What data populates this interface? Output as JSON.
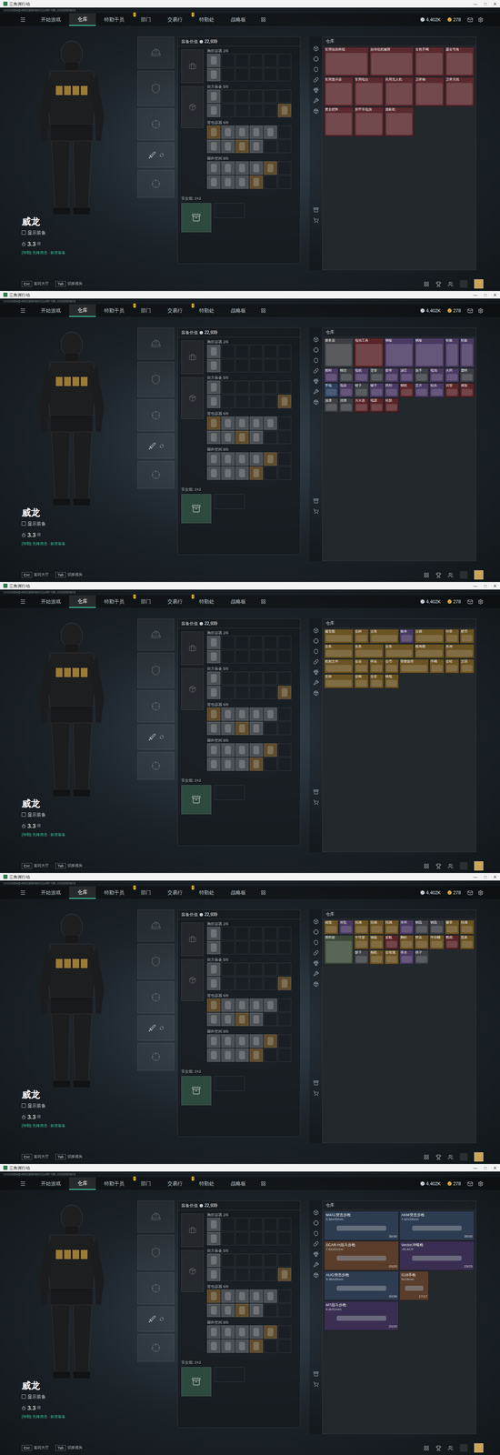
{
  "window": {
    "title": "三角洲行动",
    "controls": [
      "—",
      "□",
      "✕"
    ]
  },
  "session_id": "CH10084@49D2BB0B021148F78E.2026050823",
  "nav": {
    "tabs": [
      {
        "label": "开始游戏",
        "selected": false,
        "badge": ""
      },
      {
        "label": "仓库",
        "selected": true,
        "badge": ""
      },
      {
        "label": "特勤干员",
        "selected": false,
        "badge": ""
      },
      {
        "label": "部门",
        "selected": false,
        "badge": "!"
      },
      {
        "label": "交易行",
        "selected": false,
        "badge": ""
      },
      {
        "label": "特勤处",
        "selected": false,
        "badge": "!"
      },
      {
        "label": "战略板",
        "selected": false,
        "badge": ""
      }
    ],
    "currency": [
      {
        "value": "4.402K",
        "color": "#c9ccd0"
      },
      {
        "value": "278",
        "color": "#d9a43a"
      }
    ]
  },
  "operator": {
    "name": "威龙",
    "show_gear": {
      "label": "显示装备",
      "checked": false
    },
    "level": "3.3",
    "level_note": "级",
    "status": "[特勤] 先锋突击 · 标准装备"
  },
  "hints": [
    {
      "key": "Esc",
      "label": "返回大厅"
    },
    {
      "key": "Tab",
      "label": "切换视角"
    }
  ],
  "loadout": {
    "value_label": "装备价值",
    "value": "22,939",
    "sections": [
      {
        "label": "胸挂容器 2/6",
        "slots": [
          "ammo",
          "empty",
          "empty",
          "empty",
          "empty",
          "empty",
          "ammo",
          "empty",
          "empty",
          "empty",
          "empty",
          "empty"
        ]
      },
      {
        "label": "前方装备 5/6",
        "slots": [
          "ammo",
          "empty",
          "empty",
          "empty",
          "empty",
          "empty",
          "ammo",
          "empty",
          "empty",
          "empty",
          "empty",
          "med"
        ]
      },
      {
        "label": "背包容器 6/8",
        "slots": [
          "med",
          "ammo",
          "ammo",
          "ammo",
          "ammo",
          "empty",
          "ammo",
          "ammo",
          "med",
          "ammo",
          "empty",
          "empty"
        ]
      },
      {
        "label": "额外空间 8/8",
        "slots": [
          "ammo",
          "ammo",
          "ammo",
          "ammo",
          "med",
          "empty",
          "ammo",
          "ammo",
          "ammo",
          "med",
          "empty",
          "empty"
        ]
      }
    ],
    "safe_box": {
      "label": "安全箱: 2×2"
    }
  },
  "warehouse": {
    "title": "仓库"
  },
  "screens": [
    {
      "items": [
        {
          "name": "军用信息终端",
          "kind": "box",
          "color": "#5a2a2e"
        },
        {
          "name": "自动化机械臂",
          "kind": "box",
          "color": "#5a2a2e"
        },
        {
          "name": "金色手镯",
          "kind": "large",
          "color": "#5a2a2e"
        },
        {
          "name": "鎏金号角",
          "kind": "large",
          "color": "#5a2a2e"
        },
        {
          "name": "军用显示器",
          "kind": "large",
          "color": "#5a2a2e"
        },
        {
          "name": "军用电台",
          "kind": "large",
          "color": "#5a2a2e"
        },
        {
          "name": "民用无人机",
          "kind": "large",
          "color": "#5a2a2e"
        },
        {
          "name": "卫星锅",
          "kind": "large",
          "color": "#5a2a2e"
        },
        {
          "name": "卫星天线",
          "kind": "large",
          "color": "#5a2a2e"
        },
        {
          "name": "黄金瞪羚",
          "kind": "large",
          "color": "#5a2a2e"
        },
        {
          "name": "装甲车电池",
          "kind": "large",
          "color": "#5a2a2e"
        },
        {
          "name": "摄影机",
          "kind": "large",
          "color": "#5a2a2e"
        }
      ]
    },
    {
      "items": [
        {
          "name": "服务器",
          "kind": "large",
          "color": "#3d3f44"
        },
        {
          "name": "电动工具",
          "kind": "large",
          "color": "#5a2529"
        },
        {
          "name": "钢板",
          "kind": "large",
          "color": "#4a3a63"
        },
        {
          "name": "钢板",
          "kind": "large",
          "color": "#4a3a63"
        },
        {
          "name": "铝板",
          "kind": "tall",
          "color": "#4a3a63"
        },
        {
          "name": "铝板",
          "kind": "tall",
          "color": "#4a3a63"
        },
        {
          "name": "燃料",
          "kind": "small",
          "color": "#4a3a63"
        },
        {
          "name": "螺丝",
          "kind": "small",
          "color": "#3d4045"
        },
        {
          "name": "电线",
          "kind": "small",
          "color": "#4a3a63"
        },
        {
          "name": "雷管",
          "kind": "small",
          "color": "#3d4045"
        },
        {
          "name": "胶带",
          "kind": "small",
          "color": "#4a3a63"
        },
        {
          "name": "滤芯",
          "kind": "small",
          "color": "#4a3a63"
        },
        {
          "name": "扳手",
          "kind": "small",
          "color": "#3d4045"
        },
        {
          "name": "电池",
          "kind": "small",
          "color": "#4a3a63"
        },
        {
          "name": "火药",
          "kind": "small",
          "color": "#4a3a63"
        },
        {
          "name": "塑料",
          "kind": "small",
          "color": "#3d4045"
        },
        {
          "name": "手电",
          "kind": "small",
          "color": "#2a3f5e"
        },
        {
          "name": "电容",
          "kind": "small",
          "color": "#4a3a63"
        },
        {
          "name": "钳子",
          "kind": "small",
          "color": "#3d4045"
        },
        {
          "name": "镊子",
          "kind": "small",
          "color": "#4a3a63"
        },
        {
          "name": "药剂",
          "kind": "small",
          "color": "#4a3a63"
        },
        {
          "name": "铜线",
          "kind": "small",
          "color": "#5a2529"
        },
        {
          "name": "芯片",
          "kind": "small",
          "color": "#4a3a63"
        },
        {
          "name": "钻头",
          "kind": "small",
          "color": "#4a3a63"
        },
        {
          "name": "试管",
          "kind": "small",
          "color": "#5a2529"
        },
        {
          "name": "保险",
          "kind": "small",
          "color": "#5a2529"
        },
        {
          "name": "油漆",
          "kind": "small",
          "color": "#3d4045"
        },
        {
          "name": "清漆",
          "kind": "small",
          "color": "#3d4045"
        },
        {
          "name": "灭火器",
          "kind": "small",
          "color": "#5a2529"
        },
        {
          "name": "电源",
          "kind": "small",
          "color": "#5a2529"
        },
        {
          "name": "轮胎",
          "kind": "small",
          "color": "#5a2529"
        }
      ]
    },
    {
      "items": [
        {
          "name": "藏宝图",
          "kind": "wide",
          "color": "#6b5424"
        },
        {
          "name": "金杯",
          "kind": "small",
          "color": "#6b5424"
        },
        {
          "name": "古卷",
          "kind": "wide",
          "color": "#6b5424"
        },
        {
          "name": "账本",
          "kind": "small",
          "color": "#4a3a63"
        },
        {
          "name": "古籍",
          "kind": "wide",
          "color": "#6b5424"
        },
        {
          "name": "印章",
          "kind": "small",
          "color": "#6b5424"
        },
        {
          "name": "硬币",
          "kind": "small",
          "color": "#6b5424"
        },
        {
          "name": "金条",
          "kind": "wide",
          "color": "#6b5424"
        },
        {
          "name": "金条",
          "kind": "wide",
          "color": "#6b5424"
        },
        {
          "name": "金条",
          "kind": "wide",
          "color": "#6b5424"
        },
        {
          "name": "航海图",
          "kind": "wide",
          "color": "#6b5424"
        },
        {
          "name": "名画",
          "kind": "wide",
          "color": "#6b5424"
        },
        {
          "name": "机密文件",
          "kind": "wide",
          "color": "#6b5424"
        },
        {
          "name": "金表",
          "kind": "small",
          "color": "#6b5424"
        },
        {
          "name": "怀表",
          "kind": "small",
          "color": "#6b5424"
        },
        {
          "name": "金币",
          "kind": "small",
          "color": "#6b5424"
        },
        {
          "name": "荣誉勋章",
          "kind": "wide",
          "color": "#6b5424"
        },
        {
          "name": "手镯",
          "kind": "small",
          "color": "#6b5424"
        },
        {
          "name": "金砖",
          "kind": "small",
          "color": "#6b5424"
        },
        {
          "name": "王冠",
          "kind": "small",
          "color": "#6b5424"
        },
        {
          "name": "金块",
          "kind": "wide",
          "color": "#6b5424"
        },
        {
          "name": "金碗",
          "kind": "small",
          "color": "#6b5424"
        },
        {
          "name": "金壶",
          "kind": "small",
          "color": "#6b5424"
        },
        {
          "name": "钱包",
          "kind": "small",
          "color": "#6b5424"
        }
      ]
    },
    {
      "items": [
        {
          "name": "戒指",
          "kind": "small",
          "color": "#6b5424"
        },
        {
          "name": "吊坠",
          "kind": "small",
          "color": "#4a3a63"
        },
        {
          "name": "玩偶",
          "kind": "small",
          "color": "#6b5424"
        },
        {
          "name": "玩偶",
          "kind": "small",
          "color": "#6b5424"
        },
        {
          "name": "玩偶",
          "kind": "small",
          "color": "#6b5424"
        },
        {
          "name": "耳环",
          "kind": "small",
          "color": "#4a3a63"
        },
        {
          "name": "钥匙",
          "kind": "small",
          "color": "#3d4045"
        },
        {
          "name": "钥匙",
          "kind": "small",
          "color": "#3d4045"
        },
        {
          "name": "徽章",
          "kind": "small",
          "color": "#6b5424"
        },
        {
          "name": "玩偶",
          "kind": "small",
          "color": "#6b5424"
        },
        {
          "name": "弹药箱",
          "kind": "large",
          "color": "#3d4a3a"
        },
        {
          "name": "十字架",
          "kind": "small",
          "color": "#6b5424"
        },
        {
          "name": "项链",
          "kind": "small",
          "color": "#6b5424"
        },
        {
          "name": "瓷瓶",
          "kind": "small",
          "color": "#5a2529"
        },
        {
          "name": "胸针",
          "kind": "small",
          "color": "#6b5424"
        },
        {
          "name": "怀表",
          "kind": "small",
          "color": "#6b5424"
        },
        {
          "name": "牛仔帽",
          "kind": "small",
          "color": "#6b5424"
        },
        {
          "name": "鹦鹉",
          "kind": "small",
          "color": "#5a2529"
        },
        {
          "name": "面具",
          "kind": "small",
          "color": "#6b5424"
        },
        {
          "name": "骰子",
          "kind": "small",
          "color": "#3d4045"
        },
        {
          "name": "相机",
          "kind": "small",
          "color": "#6b5424"
        },
        {
          "name": "金玫瑰",
          "kind": "small",
          "color": "#6b5424"
        },
        {
          "name": "香水",
          "kind": "small",
          "color": "#4a3a63"
        },
        {
          "name": "棋子",
          "kind": "small",
          "color": "#3d4045"
        }
      ]
    },
    {
      "items": [
        {
          "name": "M4A1突击步枪",
          "caliber": "5.56x45mm",
          "ammo": "30/30",
          "kind": "rifle",
          "color": "#2e3c52"
        },
        {
          "name": "AKM突击步枪",
          "caliber": "7.62x39mm",
          "ammo": "30/30",
          "kind": "rifle",
          "color": "#2e3c52"
        },
        {
          "name": "SCAR-H战斗步枪",
          "caliber": "7.62x51mm",
          "ammo": "20/20",
          "kind": "rifle",
          "color": "#5a3d2a"
        },
        {
          "name": "Vector冲锋枪",
          "caliber": ".45 ACP",
          "ammo": "25/25",
          "kind": "rifle",
          "color": "#3a2f52"
        },
        {
          "name": "AUG突击步枪",
          "caliber": "5.56x45mm",
          "ammo": "30/30",
          "kind": "rifle",
          "color": "#2e3c52"
        },
        {
          "name": "G18手枪",
          "caliber": "9x19mm",
          "ammo": "17/17",
          "kind": "pistol",
          "color": "#5a3d2a"
        },
        {
          "name": "M7战斗步枪",
          "caliber": "6.8x51mm",
          "ammo": "20/20",
          "kind": "rifle",
          "color": "#3a2f52"
        }
      ]
    }
  ]
}
